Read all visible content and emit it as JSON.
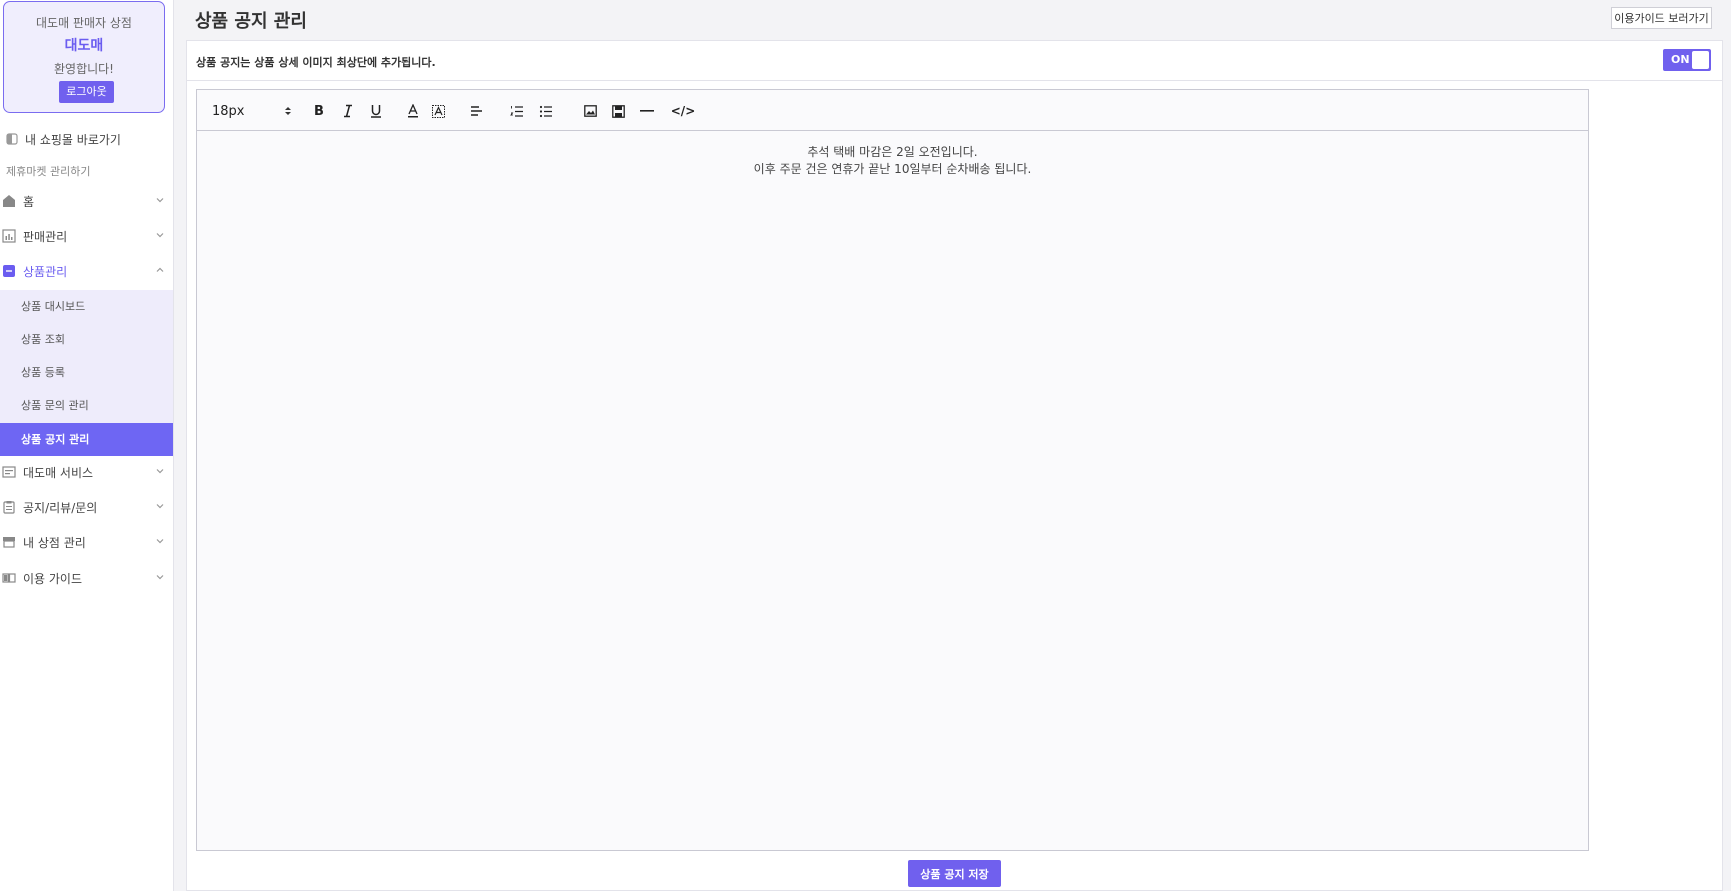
{
  "profile": {
    "greeting": "대도매 판매자 상점",
    "shop_name": "대도매",
    "welcome": "환영합니다!",
    "logout_label": "로그아웃"
  },
  "sidebar": {
    "shortcut_label": "내 쇼핑몰 바로가기",
    "section_label": "제휴마켓 관리하기",
    "menu": [
      {
        "label": "홈",
        "icon": "home-icon"
      },
      {
        "label": "판매관리",
        "icon": "chart-icon"
      },
      {
        "label": "상품관리",
        "icon": "product-icon"
      },
      {
        "label": "대도매 서비스",
        "icon": "service-icon"
      },
      {
        "label": "공지/리뷰/문의",
        "icon": "clipboard-icon"
      },
      {
        "label": "내 상점 관리",
        "icon": "store-icon"
      },
      {
        "label": "이용 가이드",
        "icon": "book-icon"
      }
    ],
    "submenu": [
      {
        "label": "상품 대시보드"
      },
      {
        "label": "상품 조회"
      },
      {
        "label": "상품 등록"
      },
      {
        "label": "상품 문의 관리"
      },
      {
        "label": "상품 공지 관리"
      }
    ]
  },
  "header": {
    "title": "상품 공지 관리",
    "guide_label": "이용가이드 보러가기"
  },
  "panel": {
    "description": "상품 공지는 상품 상세 이미지 최상단에 추가됩니다.",
    "toggle_label": "ON"
  },
  "editor": {
    "font_size": "18px",
    "content_line1": "추석 택배 마감은 2일 오전입니다.",
    "content_line2": "이후 주문 건은 연휴가 끝난 10일부터 순차배송 됩니다."
  },
  "save_label": "상품 공지 저장",
  "colors": {
    "accent": "#7060ee",
    "submenu_bg": "#eeecfb"
  }
}
